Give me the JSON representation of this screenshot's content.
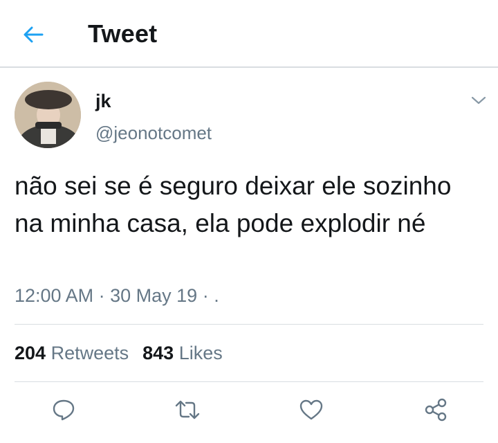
{
  "header": {
    "title": "Tweet",
    "back_icon": "arrow-left-icon"
  },
  "tweet": {
    "author": {
      "name": "jk",
      "handle": "@jeonotcomet"
    },
    "text": "não sei se é seguro deixar ele sozinho na minha casa, ela pode explodir né",
    "time": "12:00 AM",
    "date": "30 May 19",
    "separator": "·",
    "source": "."
  },
  "stats": {
    "retweets": {
      "count": "204",
      "label": "Retweets"
    },
    "likes": {
      "count": "843",
      "label": "Likes"
    }
  },
  "actions": {
    "reply_icon": "reply-icon",
    "retweet_icon": "retweet-icon",
    "like_icon": "heart-icon",
    "share_icon": "share-icon"
  },
  "colors": {
    "accent": "#1da1f2",
    "text": "#14171a",
    "secondary": "#657786",
    "divider": "#d8dde1"
  }
}
